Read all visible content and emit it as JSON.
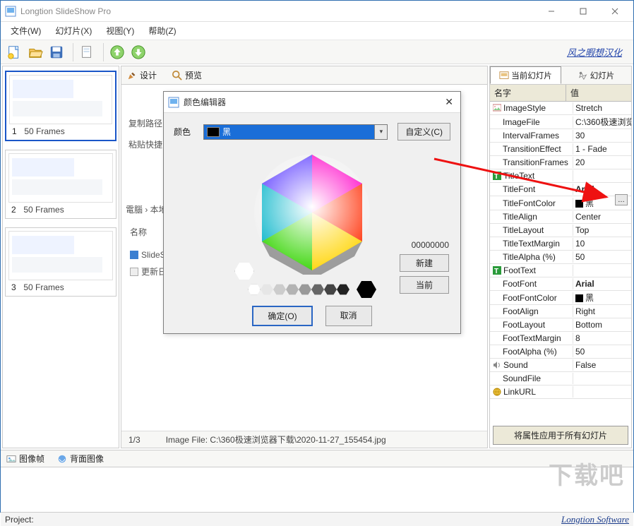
{
  "app": {
    "title": "Longtion SlideShow Pro"
  },
  "menus": [
    "文件(W)",
    "幻灯片(X)",
    "视图(Y)",
    "帮助(Z)"
  ],
  "brand_text": "风之暇想汉化",
  "frames": [
    {
      "idx": "1",
      "label": "50 Frames"
    },
    {
      "idx": "2",
      "label": "50 Frames"
    },
    {
      "idx": "3",
      "label": "50 Frames"
    }
  ],
  "worktabs": {
    "design": "设计",
    "preview": "预览"
  },
  "status": {
    "page": "1/3",
    "imagefile": "Image File: C:\\360极速浏览器下载\\2020-11-27_155454.jpg"
  },
  "bottomtabs": {
    "imageframe": "图像帧",
    "back": "背面图像"
  },
  "rtabs": {
    "current": "当前幻灯片",
    "slides": "幻灯片"
  },
  "propheader": {
    "name": "名字",
    "value": "值"
  },
  "props": [
    {
      "k": "ImageStyle",
      "v": "Stretch",
      "cat": true,
      "icon": "image"
    },
    {
      "k": "ImageFile",
      "v": "C:\\360极速浏览"
    },
    {
      "k": "IntervalFrames",
      "v": "30"
    },
    {
      "k": "TransitionEffect",
      "v": "1 - Fade"
    },
    {
      "k": "TransitionFrames",
      "v": "20"
    },
    {
      "k": "TitleText",
      "v": "",
      "cat": true,
      "icon": "titletext"
    },
    {
      "k": "TitleFont",
      "v": "Arial",
      "bold": true
    },
    {
      "k": "TitleFontColor",
      "v": "黑",
      "swatch": "#000"
    },
    {
      "k": "TitleAlign",
      "v": "Center"
    },
    {
      "k": "TitleLayout",
      "v": "Top"
    },
    {
      "k": "TitleTextMargin",
      "v": "10"
    },
    {
      "k": "TitleAlpha (%)",
      "v": "50"
    },
    {
      "k": "FootText",
      "v": "",
      "cat": true,
      "icon": "foottext"
    },
    {
      "k": "FootFont",
      "v": "Arial",
      "bold": true
    },
    {
      "k": "FootFontColor",
      "v": "黑",
      "swatch": "#000"
    },
    {
      "k": "FootAlign",
      "v": "Right"
    },
    {
      "k": "FootLayout",
      "v": "Bottom"
    },
    {
      "k": "FootTextMargin",
      "v": "8"
    },
    {
      "k": "FootAlpha (%)",
      "v": "50"
    },
    {
      "k": "Sound",
      "v": "False",
      "cat": true,
      "icon": "sound"
    },
    {
      "k": "SoundFile",
      "v": ""
    },
    {
      "k": "LinkURL",
      "v": "",
      "cat": true,
      "icon": "link"
    }
  ],
  "apply_all": "将属性应用于所有幻灯片",
  "dialog": {
    "title": "颜色编辑器",
    "color_label": "颜色",
    "color_name": "黑",
    "custom": "自定义(C)",
    "hexvalue": "00000000",
    "new_btn": "新建",
    "current_btn": "当前",
    "ok": "确定(O)",
    "cancel": "取消"
  },
  "footer": {
    "project": "Project:",
    "company": "Longtion Software"
  },
  "watermark": "下载吧"
}
